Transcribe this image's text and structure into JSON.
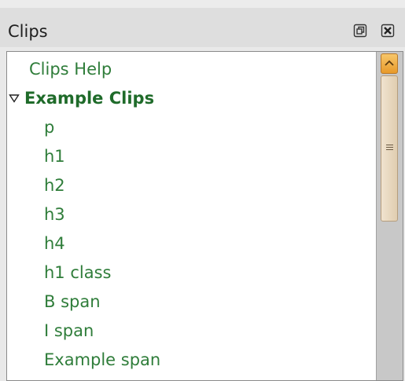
{
  "panel": {
    "title": "Clips",
    "buttons": [
      {
        "name": "restore-icon"
      },
      {
        "name": "close-icon"
      }
    ]
  },
  "tree": {
    "top_items": [
      {
        "label": "Clips Help"
      }
    ],
    "group": {
      "label": "Example Clips",
      "expanded": true,
      "icon": "expanded-triangle-icon",
      "children": [
        {
          "label": "p"
        },
        {
          "label": "h1"
        },
        {
          "label": "h2"
        },
        {
          "label": "h3"
        },
        {
          "label": "h4"
        },
        {
          "label": "h1 class"
        },
        {
          "label": "B span"
        },
        {
          "label": "I span"
        },
        {
          "label": "Example span"
        }
      ]
    }
  },
  "colors": {
    "item_text": "#2f7d3a",
    "group_text": "#1f6b2a",
    "scroll_accent": "#e89a2a"
  }
}
